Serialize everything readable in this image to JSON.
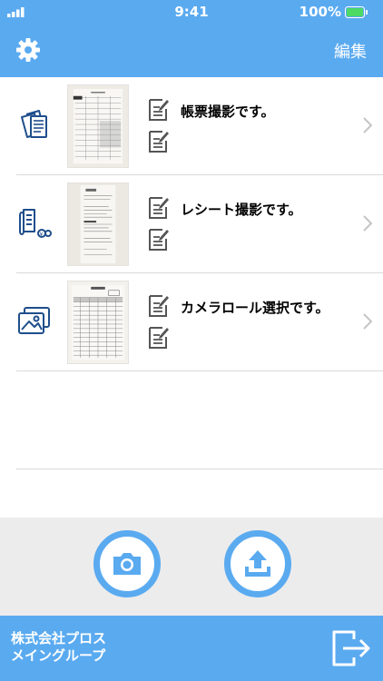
{
  "status_bar": {
    "time": "9:41",
    "battery": "100%"
  },
  "nav": {
    "edit_label": "編集",
    "settings_icon": "gear-icon"
  },
  "rows": [
    {
      "label": "帳票撮影です。",
      "icon": "documents-icon"
    },
    {
      "label": "レシート撮影です。",
      "icon": "receipt-icon"
    },
    {
      "label": "カメラロール選択です。",
      "icon": "photos-icon"
    }
  ],
  "toolbar": {
    "camera_icon": "camera-icon",
    "upload_icon": "upload-icon"
  },
  "footer": {
    "company_line1": "株式会社プロス",
    "company_line2": "メイングループ",
    "logout_icon": "logout-icon"
  },
  "colors": {
    "accent": "#5aaaf0",
    "icon_dark": "#1f4e8c",
    "toolbar_bg": "#ececec"
  }
}
